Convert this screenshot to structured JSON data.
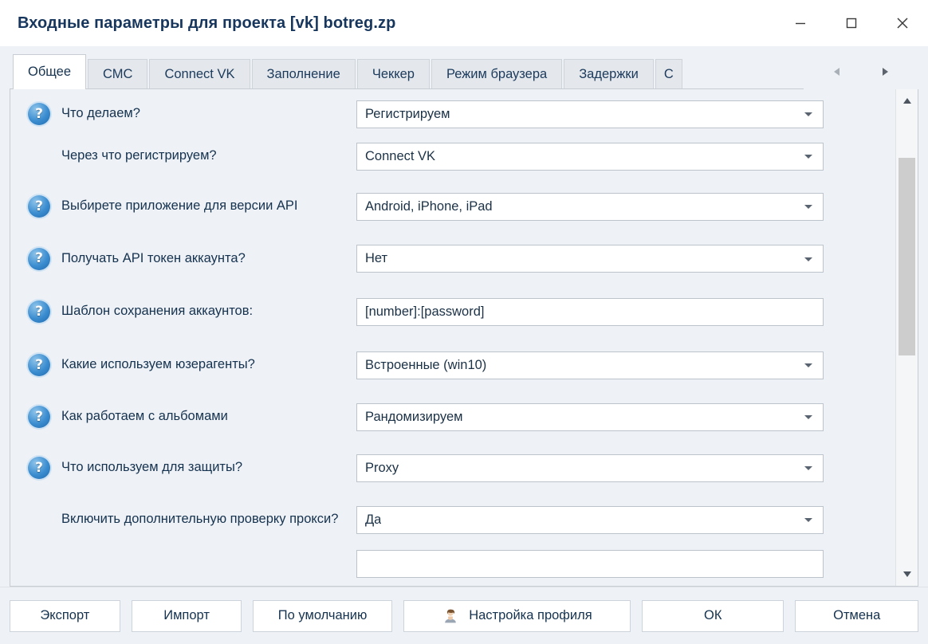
{
  "window": {
    "title": "Входные параметры для проекта [vk] botreg.zp",
    "controls": [
      {
        "name": "minimize",
        "glyph": "–"
      },
      {
        "name": "maximize",
        "glyph": "□"
      },
      {
        "name": "close",
        "glyph": "✕"
      }
    ]
  },
  "tabs": {
    "items": [
      {
        "label": "Общее",
        "active": true
      },
      {
        "label": "СМС",
        "active": false
      },
      {
        "label": "Connect VK",
        "active": false
      },
      {
        "label": "Заполнение",
        "active": false
      },
      {
        "label": "Чеккер",
        "active": false
      },
      {
        "label": "Режим браузера",
        "active": false
      },
      {
        "label": "Задержки",
        "active": false
      },
      {
        "label": "С",
        "active": false
      }
    ],
    "scroll_left": "◀",
    "scroll_right": "▶"
  },
  "form": {
    "rows": [
      {
        "help": true,
        "label": "Что делаем?",
        "control": "combo",
        "value": "Регистрируем"
      },
      {
        "help": false,
        "label": "Через что регистрируем?",
        "control": "combo",
        "value": "Connect VK"
      },
      {
        "help": true,
        "label": "Выбирете приложение для версии API",
        "control": "combo",
        "value": "Android, iPhone, iPad"
      },
      {
        "help": true,
        "label": "Получать API токен аккаунта?",
        "control": "combo",
        "value": "Нет"
      },
      {
        "help": true,
        "label": "Шаблон сохранения аккаунтов:",
        "control": "textbox",
        "value": "[number]:[password]"
      },
      {
        "help": true,
        "label": "Какие используем юзерагенты?",
        "control": "combo",
        "value": "Встроенные (win10)"
      },
      {
        "help": true,
        "label": "Как работаем с альбомами",
        "control": "combo",
        "value": "Рандомизируем"
      },
      {
        "help": true,
        "label": "Что используем для защиты?",
        "control": "combo",
        "value": "Proxy"
      },
      {
        "help": false,
        "label": "Включить дополнительную проверку прокси?",
        "control": "combo",
        "value": "Да"
      }
    ],
    "help_glyph": "?"
  },
  "scrollbar": {
    "up_arrow": "▲",
    "down_arrow": "▼"
  },
  "footer": {
    "export": "Экспорт",
    "import": "Импорт",
    "defaults": "По умолчанию",
    "profile": "Настройка профиля",
    "ok": "ОК",
    "cancel": "Отмена"
  },
  "colors": {
    "title_text": "#17365d",
    "dialog_bg": "#eef1f5",
    "field_bg": "#ffffff",
    "border": "#bcc3cb",
    "help_icon_blue": "#3b8dd0",
    "scroll_thumb": "#cdcdcd"
  }
}
